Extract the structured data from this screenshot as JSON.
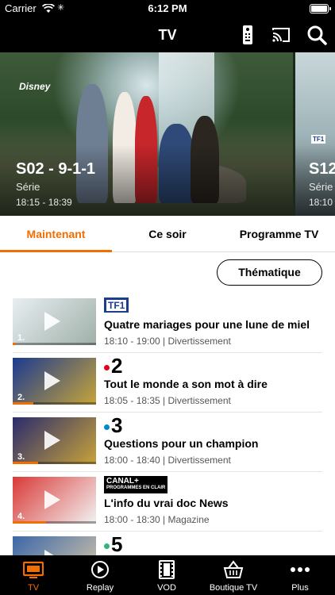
{
  "status_bar": {
    "carrier": "Carrier",
    "time": "6:12 PM"
  },
  "nav": {
    "title": "TV",
    "icons": [
      "remote-icon",
      "cast-icon",
      "search-icon"
    ]
  },
  "hero": {
    "cards": [
      {
        "channel": "Disney",
        "title": "S02 - 9-1-1",
        "type": "Série",
        "time": "18:15 - 18:39"
      },
      {
        "channel": "TF1",
        "title": "S12",
        "type": "Série",
        "time": "18:10"
      }
    ]
  },
  "tabs": {
    "items": [
      "Maintenant",
      "Ce soir",
      "Programme TV"
    ],
    "active": "Maintenant"
  },
  "filter": {
    "label": "Thématique"
  },
  "programs": [
    {
      "number": "1.",
      "channel": "TF1",
      "title": "Quatre mariages pour une lune de miel",
      "meta": "18:10 - 19:00 | Divertissement",
      "progress": 0.04,
      "thumb_colors": [
        "#e8eef2",
        "#9fb0a8"
      ]
    },
    {
      "number": "2.",
      "channel": "2",
      "channel_dot": "#e2001a",
      "title": "Tout le monde a son mot à dire",
      "meta": "18:05 - 18:35 | Divertissement",
      "progress": 0.25,
      "thumb_colors": [
        "#1b3a8f",
        "#c7a43a"
      ]
    },
    {
      "number": "3.",
      "channel": "3",
      "channel_dot": "#0088cc",
      "title": "Questions pour un champion",
      "meta": "18:00 - 18:40 | Divertissement",
      "progress": 0.3,
      "thumb_colors": [
        "#2a2b6d",
        "#c8a33a"
      ]
    },
    {
      "number": "4.",
      "channel": "CANAL+",
      "channel_sub": "PROGRAMMES EN CLAIR",
      "title": "L'info du vrai doc News",
      "meta": "18:00 - 18:30 | Magazine",
      "progress": 0.4,
      "thumb_colors": [
        "#d93a37",
        "#f2f2f2"
      ]
    },
    {
      "number": "5.",
      "channel": "5",
      "channel_dot": "#2fb67a",
      "title": "",
      "meta": "",
      "progress": 0.1,
      "thumb_colors": [
        "#3b67a8",
        "#d8c9a8"
      ]
    }
  ],
  "tabbar": {
    "items": [
      {
        "label": "TV",
        "icon": "tv-icon"
      },
      {
        "label": "Replay",
        "icon": "replay-icon"
      },
      {
        "label": "VOD",
        "icon": "film-icon"
      },
      {
        "label": "Boutique TV",
        "icon": "basket-icon"
      },
      {
        "label": "Plus",
        "icon": "more-icon"
      }
    ],
    "active": "TV"
  },
  "colors": {
    "accent": "#f16e00",
    "bar_bg": "#000000"
  }
}
